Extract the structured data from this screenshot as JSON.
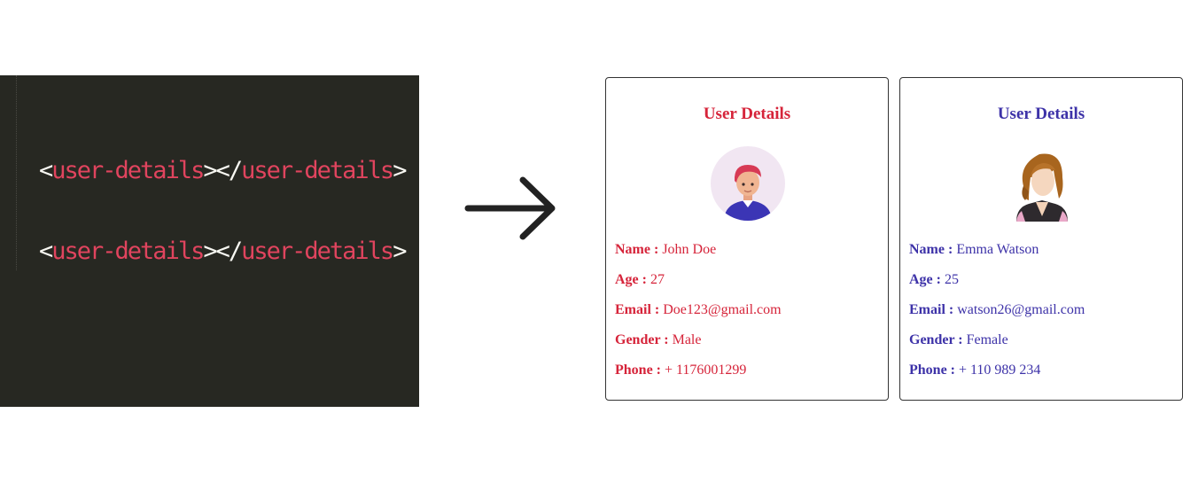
{
  "editor": {
    "lines": [
      {
        "open_lt": "<",
        "open_tag": "user-details",
        "open_gt": ">",
        "close_lt": "</",
        "close_tag": "user-details",
        "close_gt": ">"
      },
      {
        "open_lt": "<",
        "open_tag": "user-details",
        "open_gt": ">",
        "close_lt": "</",
        "close_tag": "user-details",
        "close_gt": ">"
      }
    ],
    "colors": {
      "background": "#272822",
      "tag": "#e0445e",
      "punct": "#f8f8f2"
    }
  },
  "arrow": {
    "icon": "arrow-right-icon",
    "color": "#222222"
  },
  "cards": [
    {
      "title": "User Details",
      "accent": "#d6243a",
      "avatar_icon": "male-avatar-icon",
      "fields": [
        {
          "label": "Name :",
          "value": "John Doe"
        },
        {
          "label": "Age :",
          "value": "27"
        },
        {
          "label": "Email :",
          "value": "Doe123@gmail.com"
        },
        {
          "label": "Gender :",
          "value": "Male"
        },
        {
          "label": "Phone :",
          "value": "+ 1176001299"
        }
      ]
    },
    {
      "title": "User Details",
      "accent": "#3d32a8",
      "avatar_icon": "female-avatar-icon",
      "fields": [
        {
          "label": "Name :",
          "value": "Emma Watson"
        },
        {
          "label": "Age :",
          "value": "25"
        },
        {
          "label": "Email :",
          "value": "watson26@gmail.com"
        },
        {
          "label": "Gender :",
          "value": "Female"
        },
        {
          "label": "Phone :",
          "value": "+ 110 989 234"
        }
      ]
    }
  ]
}
